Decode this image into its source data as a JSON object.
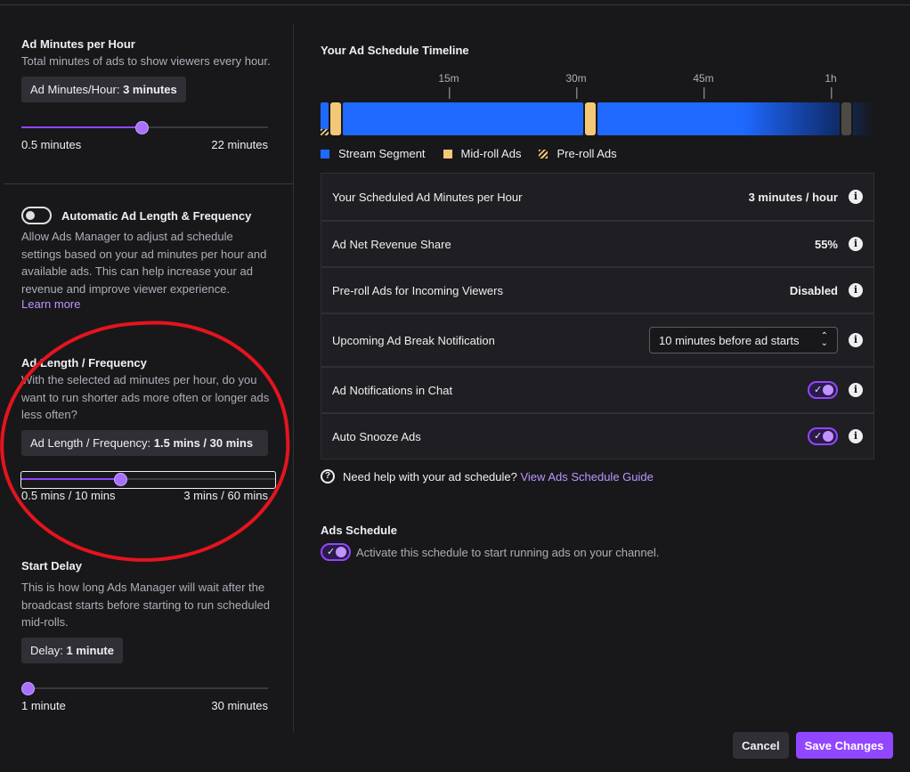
{
  "sidebar": {
    "ad_minutes": {
      "title": "Ad Minutes per Hour",
      "desc": "Total minutes of ads to show viewers every hour.",
      "chip_label": "Ad Minutes/Hour:",
      "chip_value": "3 minutes",
      "min": "0.5 minutes",
      "max": "22 minutes",
      "level": 0.49
    },
    "auto": {
      "title": "Automatic Ad Length & Frequency",
      "desc": "Allow Ads Manager to adjust ad schedule settings based on your ad minutes per hour and available ads. This can help increase your ad revenue and improve viewer experience.",
      "link": "Learn more",
      "enabled": false
    },
    "length": {
      "title": "Ad Length / Frequency",
      "desc": "With the selected ad minutes per hour, do you want to run shorter ads more often or longer ads less often?",
      "chip_label": "Ad Length / Frequency:",
      "chip_value": "1.5 mins / 30 mins",
      "min": "0.5 mins / 10 mins",
      "max": "3 mins / 60 mins",
      "level": 0.4
    },
    "delay": {
      "title": "Start Delay",
      "desc": "This is how long Ads Manager will wait after the broadcast starts before starting to run scheduled mid-rolls.",
      "chip_label": "Delay:",
      "chip_value": "1 minute",
      "min": "1 minute",
      "max": "30 minutes",
      "level": 0.0
    }
  },
  "timeline": {
    "title": "Your Ad Schedule Timeline",
    "ticks": [
      "15m",
      "30m",
      "45m",
      "1h"
    ],
    "legend": [
      "Stream Segment",
      "Mid-roll Ads",
      "Pre-roll Ads"
    ],
    "colors": {
      "stream": "#1f69ff",
      "midroll": "#f5c877",
      "accent": "#9147ff"
    }
  },
  "settings": [
    {
      "label": "Your Scheduled Ad Minutes per Hour",
      "value": "3 minutes / hour"
    },
    {
      "label": "Ad Net Revenue Share",
      "value": "55%"
    },
    {
      "label": "Pre-roll Ads for Incoming Viewers",
      "value": "Disabled"
    },
    {
      "label": "Upcoming Ad Break Notification",
      "value": "10 minutes before ad starts"
    },
    {
      "label": "Ad Notifications in Chat",
      "value": "on"
    },
    {
      "label": "Auto Snooze Ads",
      "value": "on"
    }
  ],
  "help": {
    "text": "Need help with your ad schedule?",
    "link": "View Ads Schedule Guide"
  },
  "schedule": {
    "title": "Ads Schedule",
    "desc": "Activate this schedule to start running ads on your channel."
  },
  "buttons": {
    "cancel": "Cancel",
    "save": "Save Changes"
  }
}
